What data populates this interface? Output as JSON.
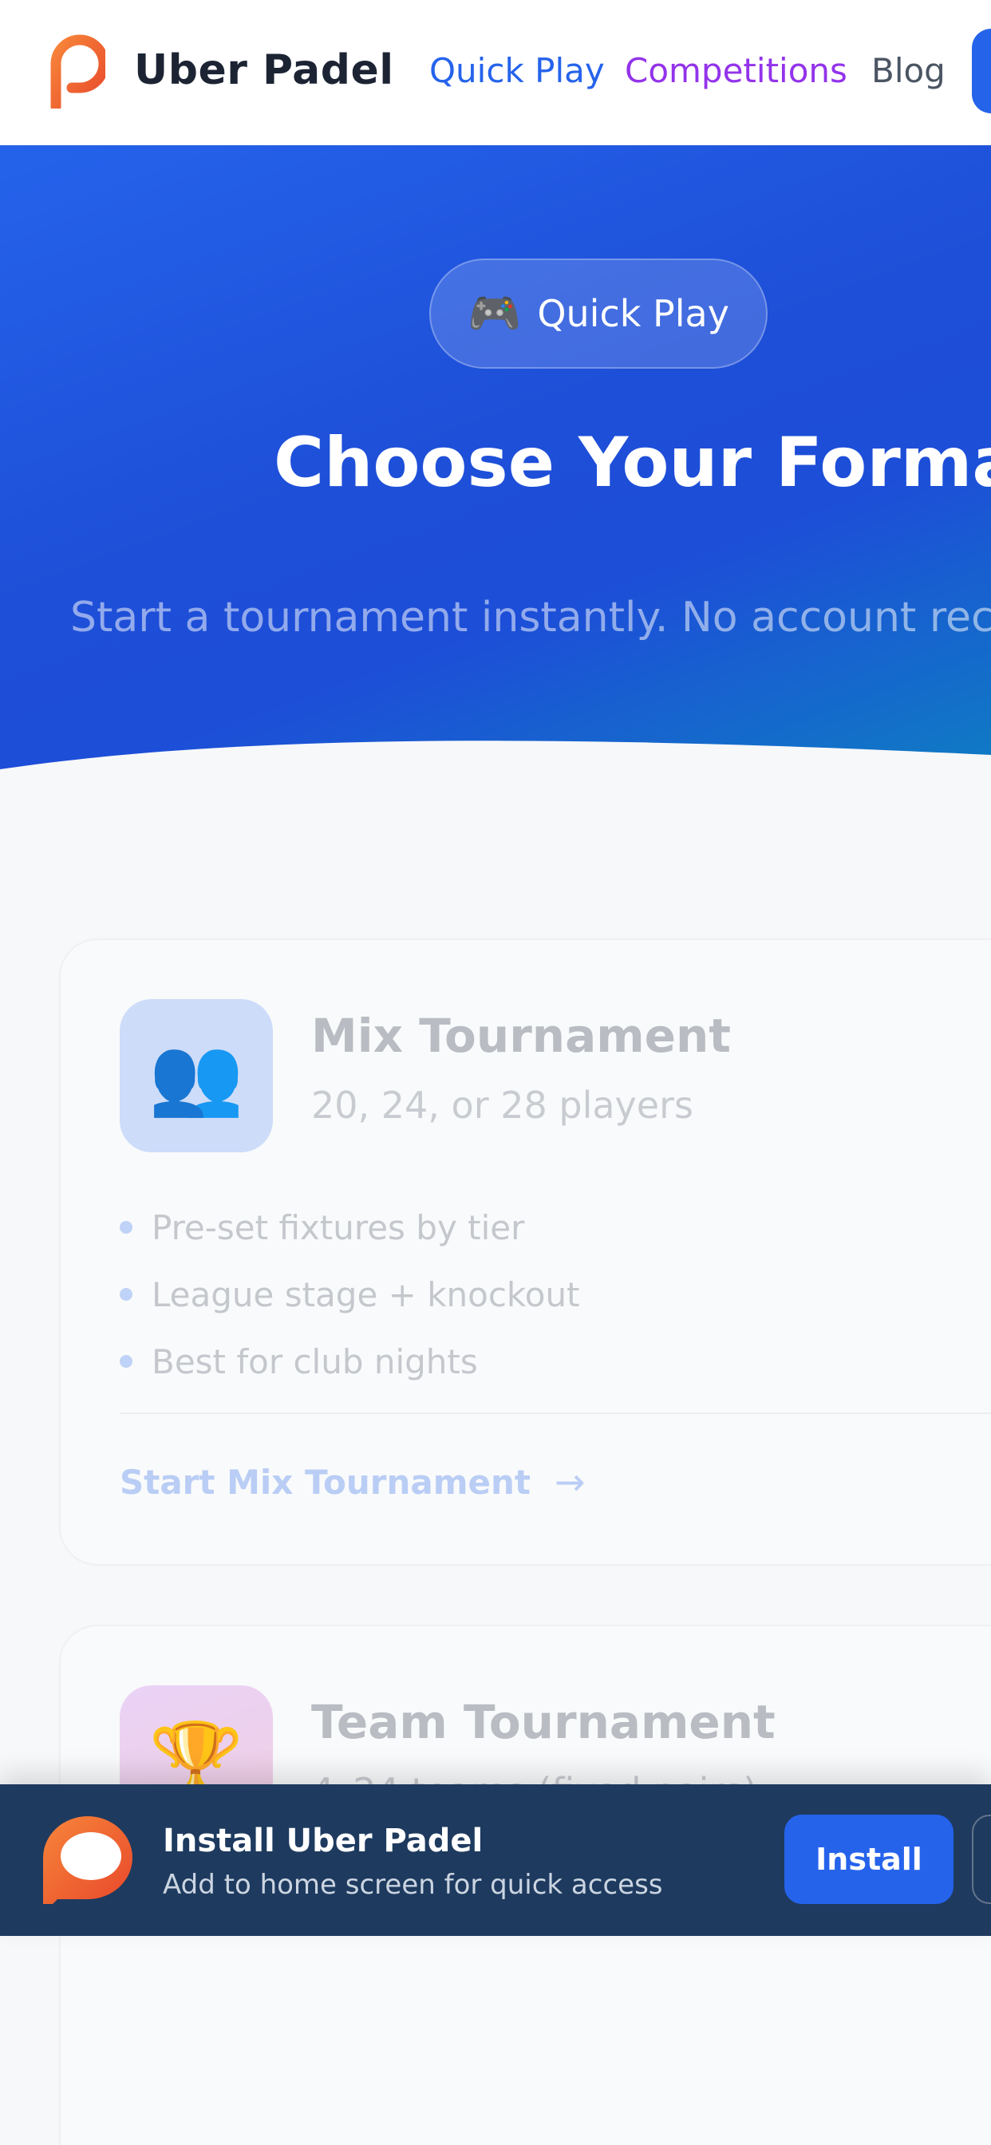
{
  "header": {
    "brand": "Uber Padel",
    "nav": {
      "quick_play": "Quick Play",
      "competitions": "Competitions",
      "blog": "Blog"
    }
  },
  "hero": {
    "badge_icon": "🎮",
    "badge_label": "Quick Play",
    "title": "Choose Your Format",
    "subtitle": "Start a tournament instantly. No account rec"
  },
  "cards": [
    {
      "icon": "👥",
      "icon_name": "people-icon",
      "title": "Mix Tournament",
      "subtitle": "20, 24, or 28 players",
      "features": [
        "Pre-set fixtures by tier",
        "League stage + knockout",
        "Best for club nights"
      ],
      "cta": "Start Mix Tournament",
      "cta_arrow": "→"
    },
    {
      "icon": "🏆",
      "icon_name": "trophy-icon",
      "title": "Team Tournament",
      "subtitle": "4–24 teams (fixed pairs)"
    }
  ],
  "install_banner": {
    "title": "Install Uber Padel",
    "description": "Add to home screen for quick access",
    "install_label": "Install"
  },
  "colors": {
    "primary": "#2563eb",
    "competitions": "#9333ea",
    "logo_orange": "#f26b2a",
    "banner_bg": "#1e3a5f"
  }
}
